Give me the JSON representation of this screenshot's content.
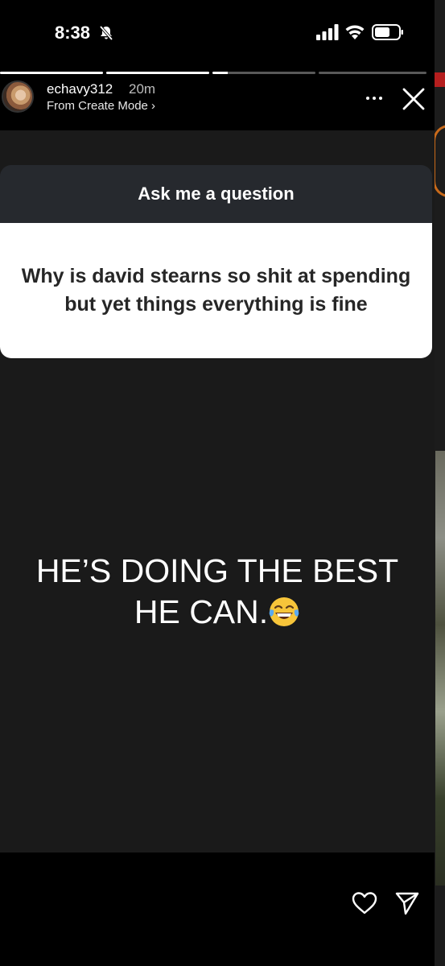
{
  "status_bar": {
    "time": "8:38"
  },
  "story": {
    "username": "echavy312",
    "time_ago": "20m",
    "subtitle": "From Create Mode ›",
    "progress": [
      1.0,
      1.0,
      0.15,
      0.0
    ]
  },
  "question_sticker": {
    "title": "Ask me a question",
    "question": "Why is david stearns so shit at spending but yet things everything is fine"
  },
  "answer": {
    "text": "HE’S DOING THE BEST HE CAN."
  },
  "icons": {
    "bell": "bell-muted-icon",
    "signal": "signal-icon",
    "wifi": "wifi-icon",
    "battery": "battery-icon",
    "more": "more-icon",
    "close": "close-icon",
    "emoji": "laughing-tears-emoji",
    "like": "heart-icon",
    "send": "send-icon"
  },
  "colors": {
    "card_background": "#1a1a1a",
    "sticker_header": "#26292e",
    "sticker_body": "#ffffff"
  }
}
